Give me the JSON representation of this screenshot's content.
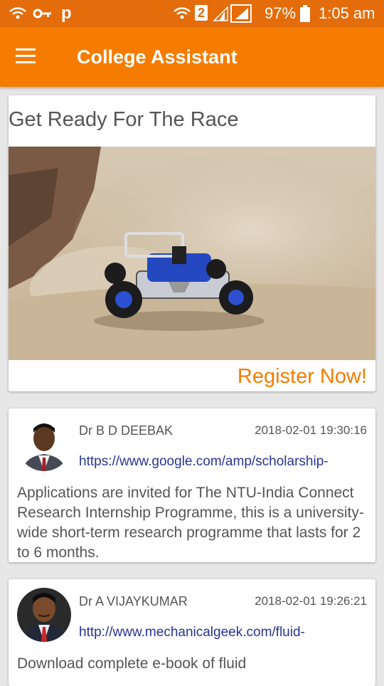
{
  "status_bar": {
    "battery": "97%",
    "time": "1:05 am",
    "sim_slot": "2",
    "app_letter": "p"
  },
  "app_bar": {
    "title": "College Assistant"
  },
  "banner": {
    "title": "Get Ready For The Race",
    "cta": "Register Now!"
  },
  "posts": [
    {
      "author": "Dr B D DEEBAK",
      "timestamp": "2018-02-01 19:30:16",
      "link": "https://www.google.com/amp/scholarship-",
      "text": "Applications are invited for The NTU-India Connect Research Internship Programme, this is a university-wide short-term research programme that lasts for 2 to 6 months."
    },
    {
      "author": "Dr A VIJAYKUMAR",
      "timestamp": "2018-02-01 19:26:21",
      "link": "http://www.mechanicalgeek.com/fluid-",
      "text": "Download complete e-book of fluid"
    }
  ],
  "colors": {
    "status_bar": "#e46c0a",
    "app_bar": "#f57c00",
    "accent": "#f57c00",
    "link": "#283593",
    "background": "#e7e7e7"
  }
}
